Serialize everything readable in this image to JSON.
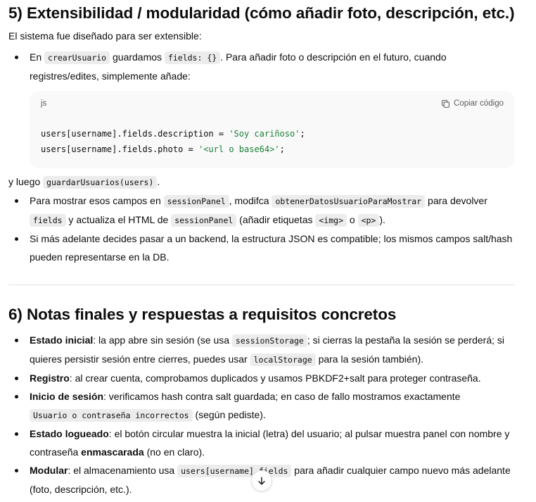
{
  "section5": {
    "title": "5) Extensibilidad / modularidad (cómo añadir foto, descripción, etc.)",
    "intro": "El sistema fue diseñado para ser extensible:",
    "b1_t1": "En ",
    "b1_c1": "crearUsuario",
    "b1_t2": " guardamos ",
    "b1_c2": "fields: {}",
    "b1_t3": ". Para añadir foto o descripción en el futuro, cuando registres/edites, simplemente añade:",
    "code": {
      "lang": "js",
      "copy_label": "Copiar código",
      "line1_pre": "users[username].fields.description = ",
      "line1_str": "'Soy cariñoso'",
      "line1_post": ";",
      "line2_pre": "users[username].fields.photo = ",
      "line2_str": "'<url o base64>'",
      "line2_post": ";"
    },
    "after_t1": "y luego ",
    "after_c1": "guardarUsuarios(users)",
    "after_t2": ".",
    "b2_t1": "Para mostrar esos campos en ",
    "b2_c1": "sessionPanel",
    "b2_t2": ", modifca ",
    "b2_c2": "obtenerDatosUsuarioParaMostrar",
    "b2_t3": " para devolver ",
    "b2_c3": "fields",
    "b2_t4": " y actualiza el HTML de ",
    "b2_c4": "sessionPanel",
    "b2_t5": " (añadir etiquetas ",
    "b2_c5": "<img>",
    "b2_t6": " o ",
    "b2_c6": "<p>",
    "b2_t7": ").",
    "b3": "Si más adelante decides pasar a un backend, la estructura JSON es compatible; los mismos campos salt/hash pueden representarse en la DB."
  },
  "section6": {
    "title": "6) Notas finales y respuestas a requisitos concretos",
    "i1_b": "Estado inicial",
    "i1_t1": ": la app abre sin sesión (se usa ",
    "i1_c1": "sessionStorage",
    "i1_t2": "; si cierras la pestaña la sesión se perderá; si quieres persistir sesión entre cierres, puedes usar ",
    "i1_c2": "localStorage",
    "i1_t3": " para la sesión también).",
    "i2_b": "Registro",
    "i2_t1": ": al crear cuenta, comprobamos duplicados y usamos PBKDF2+salt para proteger contraseña.",
    "i3_b": "Inicio de sesión",
    "i3_t1": ": verificamos hash contra salt guardada; en caso de fallo mostramos exactamente ",
    "i3_c1": "Usuario o contraseña incorrectos",
    "i3_t2": " (según pediste).",
    "i4_b": "Estado logueado",
    "i4_t1": ": el botón circular muestra la inicial (letra) del usuario; al pulsar muestra panel con nombre y contraseña ",
    "i4_b2": "enmascarada",
    "i4_t2": " (no en claro).",
    "i5_b": "Modular",
    "i5_t1": ": el almacenamiento usa ",
    "i5_c1": "users[username].fields",
    "i5_t2": " para añadir cualquier campo nuevo más adelante (foto, descripción, etc.)."
  },
  "icons": {
    "copy": "copy-icon",
    "scroll": "arrow-down-icon"
  }
}
